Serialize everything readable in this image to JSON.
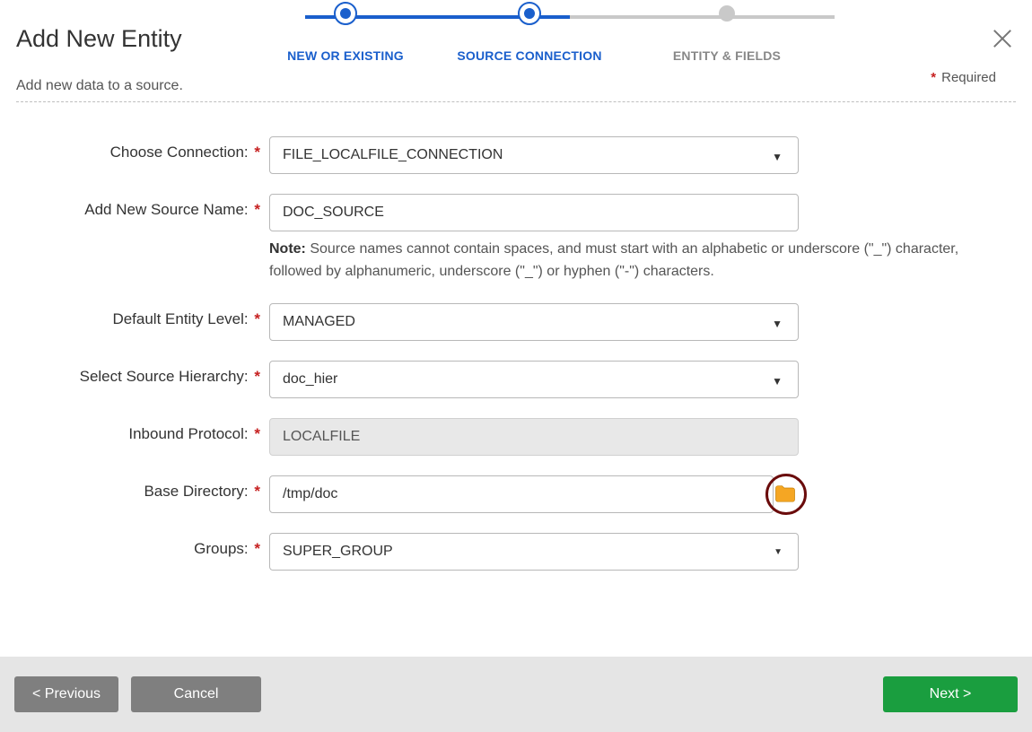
{
  "header": {
    "title": "Add New Entity",
    "subtitle": "Add new data to a source.",
    "required_label": "Required",
    "required_star": "*"
  },
  "stepper": {
    "steps": [
      {
        "label": "NEW OR EXISTING"
      },
      {
        "label": "SOURCE CONNECTION"
      },
      {
        "label": "ENTITY & FIELDS"
      }
    ]
  },
  "form": {
    "choose_connection": {
      "label": "Choose Connection:",
      "value": "FILE_LOCALFILE_CONNECTION"
    },
    "source_name": {
      "label": "Add New Source Name:",
      "value": "DOC_SOURCE"
    },
    "note": {
      "bold": "Note:",
      "text": " Source names cannot contain spaces, and must start with an alphabetic or underscore (\"_\") character, followed by alphanumeric, underscore (\"_\") or hyphen (\"-\") characters."
    },
    "entity_level": {
      "label": "Default Entity Level:",
      "value": "MANAGED"
    },
    "source_hierarchy": {
      "label": "Select Source Hierarchy:",
      "value": "doc_hier"
    },
    "inbound_protocol": {
      "label": "Inbound Protocol:",
      "value": "LOCALFILE"
    },
    "base_directory": {
      "label": "Base Directory:",
      "value": "/tmp/doc"
    },
    "groups": {
      "label": "Groups:",
      "value": "SUPER_GROUP"
    },
    "star": "*",
    "caret": "▼"
  },
  "footer": {
    "previous": "< Previous",
    "cancel": "Cancel",
    "next": "Next >"
  }
}
